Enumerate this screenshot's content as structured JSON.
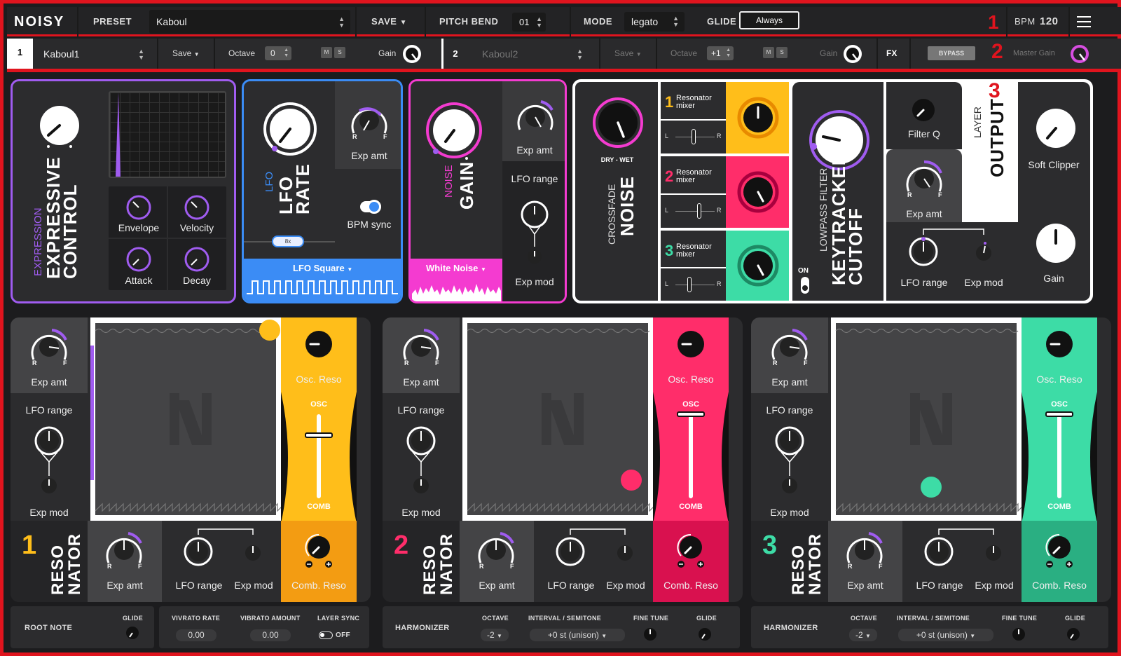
{
  "header": {
    "logo": "NOISY",
    "preset_label": "PRESET",
    "preset_value": "Kaboul",
    "save": "SAVE",
    "pitch_bend_label": "PITCH BEND",
    "pitch_bend_value": "01",
    "mode_label": "MODE",
    "mode_value": "legato",
    "glide_label": "GLIDE",
    "glide_value": "Always",
    "annotation": "1",
    "bpm_label": "BPM",
    "bpm_value": "120"
  },
  "layers": {
    "l1_num": "1",
    "l1_name": "Kaboul1",
    "save": "Save",
    "octave_label": "Octave",
    "l1_octave": "0",
    "m": "M",
    "s": "S",
    "gain": "Gain",
    "l2_num": "2",
    "l2_name": "Kaboul2",
    "l2_octave": "+1",
    "fx": "FX",
    "bypass": "BYPASS",
    "annotation": "2",
    "master_gain": "Master Gain"
  },
  "expressive": {
    "small": "EXPRESSION",
    "line1": "EXPRESSIVE",
    "line2": "CONTROL",
    "envelope": "Envelope",
    "velocity": "Velocity",
    "attack": "Attack",
    "decay": "Decay"
  },
  "lfo": {
    "small": "LFO",
    "line1": "LFO",
    "line2": "RATE",
    "exp_amt": "Exp amt",
    "r": "R",
    "f": "F",
    "bpm_sync": "BPM sync",
    "slider": "8x",
    "shape": "LFO Square"
  },
  "noise": {
    "small": "NOISE",
    "line1": "GAIN",
    "exp_amt": "Exp amt",
    "lfo_range": "LFO range",
    "exp_mod": "Exp mod",
    "type": "White Noise"
  },
  "output": {
    "dry_wet": "DRY - WET",
    "crossfade": "CROSSFADE",
    "noise": "NOISE",
    "res1_num": "1",
    "res2_num": "2",
    "res3_num": "3",
    "res_mixer": "Resonator mixer",
    "l": "L",
    "r": "R",
    "on": "ON",
    "lp_small": "LOWPASS FILTER",
    "lp1": "KEYTRACKED",
    "lp2": "CUTOFF",
    "filter_q": "Filter Q",
    "exp_amt": "Exp amt",
    "lfo_range": "LFO range",
    "exp_mod": "Exp mod",
    "layer_small": "LAYER",
    "layer_big": "OUTPUT",
    "annotation": "3",
    "soft_clipper": "Soft Clipper",
    "gain": "Gain"
  },
  "resonators": [
    {
      "num": "1",
      "title1": "RESO",
      "title2": "NATOR",
      "color": "#ffbe1a",
      "dark": "#f39c12"
    },
    {
      "num": "2",
      "title1": "RESO",
      "title2": "NATOR",
      "color": "#ff2d6a",
      "dark": "#d9114f"
    },
    {
      "num": "3",
      "title1": "RESO",
      "title2": "NATOR",
      "color": "#3ddca6",
      "dark": "#2aaf82"
    }
  ],
  "reso_labels": {
    "exp_amt": "Exp amt",
    "lfo_range": "LFO range",
    "exp_mod": "Exp mod",
    "osc_reso": "Osc. Reso",
    "osc": "OSC",
    "comb": "COMB",
    "comb_reso": "Comb. Reso",
    "r": "R",
    "f": "F"
  },
  "bottom": {
    "root_note": "ROOT NOTE",
    "glide": "GLIDE",
    "vib_rate": "VIVRATO RATE",
    "vib_amount": "VIBRATO AMOUNT",
    "layer_sync": "LAYER SYNC",
    "vib_rate_val": "0.00",
    "vib_amount_val": "0.00",
    "off": "OFF",
    "harmonizer": "HARMONIZER",
    "octave": "OCTAVE",
    "interval": "INTERVAL / SEMITONE",
    "fine_tune": "FINE TUNE",
    "octave_val": "-2",
    "interval_val": "+0 st (unison)"
  },
  "colors": {
    "purple": "#a05cf0",
    "blue": "#3b8cf5",
    "pink": "#f43bd0",
    "yellow": "#ffbe1a",
    "red": "#ff2d6a",
    "green": "#3ddca6",
    "frame": "#e0141e"
  }
}
